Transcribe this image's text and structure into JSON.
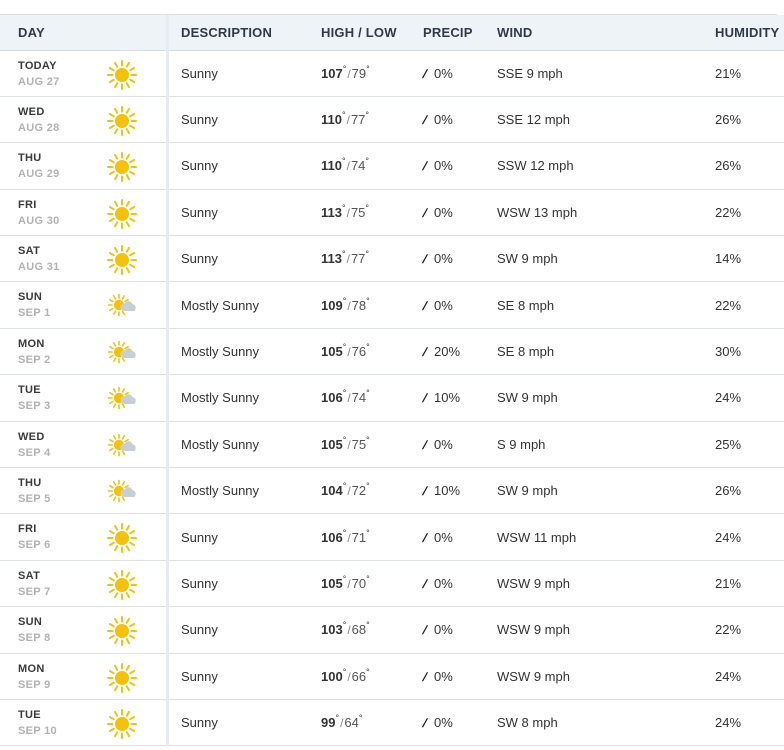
{
  "headers": {
    "day": "DAY",
    "description": "DESCRIPTION",
    "high_low": "HIGH / LOW",
    "precip": "PRECIP",
    "wind": "WIND",
    "humidity": "HUMIDITY"
  },
  "colors": {
    "sun": "#f4c20d",
    "cloud": "#c9ced4",
    "header_bg": "#eef3f8"
  },
  "rows": [
    {
      "dow": "TODAY",
      "date": "AUG 27",
      "icon": "sunny-icon",
      "desc": "Sunny",
      "high": "107",
      "low": "79",
      "precip": "0%",
      "wind": "SSE 9 mph",
      "humidity": "21%"
    },
    {
      "dow": "WED",
      "date": "AUG 28",
      "icon": "sunny-icon",
      "desc": "Sunny",
      "high": "110",
      "low": "77",
      "precip": "0%",
      "wind": "SSE 12 mph",
      "humidity": "26%"
    },
    {
      "dow": "THU",
      "date": "AUG 29",
      "icon": "sunny-icon",
      "desc": "Sunny",
      "high": "110",
      "low": "74",
      "precip": "0%",
      "wind": "SSW 12 mph",
      "humidity": "26%"
    },
    {
      "dow": "FRI",
      "date": "AUG 30",
      "icon": "sunny-icon",
      "desc": "Sunny",
      "high": "113",
      "low": "75",
      "precip": "0%",
      "wind": "WSW 13 mph",
      "humidity": "22%"
    },
    {
      "dow": "SAT",
      "date": "AUG 31",
      "icon": "sunny-icon",
      "desc": "Sunny",
      "high": "113",
      "low": "77",
      "precip": "0%",
      "wind": "SW 9 mph",
      "humidity": "14%"
    },
    {
      "dow": "SUN",
      "date": "SEP 1",
      "icon": "mostly-sunny-icon",
      "desc": "Mostly Sunny",
      "high": "109",
      "low": "78",
      "precip": "0%",
      "wind": "SE 8 mph",
      "humidity": "22%"
    },
    {
      "dow": "MON",
      "date": "SEP 2",
      "icon": "mostly-sunny-icon",
      "desc": "Mostly Sunny",
      "high": "105",
      "low": "76",
      "precip": "20%",
      "wind": "SE 8 mph",
      "humidity": "30%"
    },
    {
      "dow": "TUE",
      "date": "SEP 3",
      "icon": "mostly-sunny-icon",
      "desc": "Mostly Sunny",
      "high": "106",
      "low": "74",
      "precip": "10%",
      "wind": "SW 9 mph",
      "humidity": "24%"
    },
    {
      "dow": "WED",
      "date": "SEP 4",
      "icon": "mostly-sunny-icon",
      "desc": "Mostly Sunny",
      "high": "105",
      "low": "75",
      "precip": "0%",
      "wind": "S 9 mph",
      "humidity": "25%"
    },
    {
      "dow": "THU",
      "date": "SEP 5",
      "icon": "mostly-sunny-icon",
      "desc": "Mostly Sunny",
      "high": "104",
      "low": "72",
      "precip": "10%",
      "wind": "SW 9 mph",
      "humidity": "26%"
    },
    {
      "dow": "FRI",
      "date": "SEP 6",
      "icon": "sunny-icon",
      "desc": "Sunny",
      "high": "106",
      "low": "71",
      "precip": "0%",
      "wind": "WSW 11 mph",
      "humidity": "24%"
    },
    {
      "dow": "SAT",
      "date": "SEP 7",
      "icon": "sunny-icon",
      "desc": "Sunny",
      "high": "105",
      "low": "70",
      "precip": "0%",
      "wind": "WSW 9 mph",
      "humidity": "21%"
    },
    {
      "dow": "SUN",
      "date": "SEP 8",
      "icon": "sunny-icon",
      "desc": "Sunny",
      "high": "103",
      "low": "68",
      "precip": "0%",
      "wind": "WSW 9 mph",
      "humidity": "22%"
    },
    {
      "dow": "MON",
      "date": "SEP 9",
      "icon": "sunny-icon",
      "desc": "Sunny",
      "high": "100",
      "low": "66",
      "precip": "0%",
      "wind": "WSW 9 mph",
      "humidity": "24%"
    },
    {
      "dow": "TUE",
      "date": "SEP 10",
      "icon": "sunny-icon",
      "desc": "Sunny",
      "high": "99",
      "low": "64",
      "precip": "0%",
      "wind": "SW 8 mph",
      "humidity": "24%"
    }
  ]
}
